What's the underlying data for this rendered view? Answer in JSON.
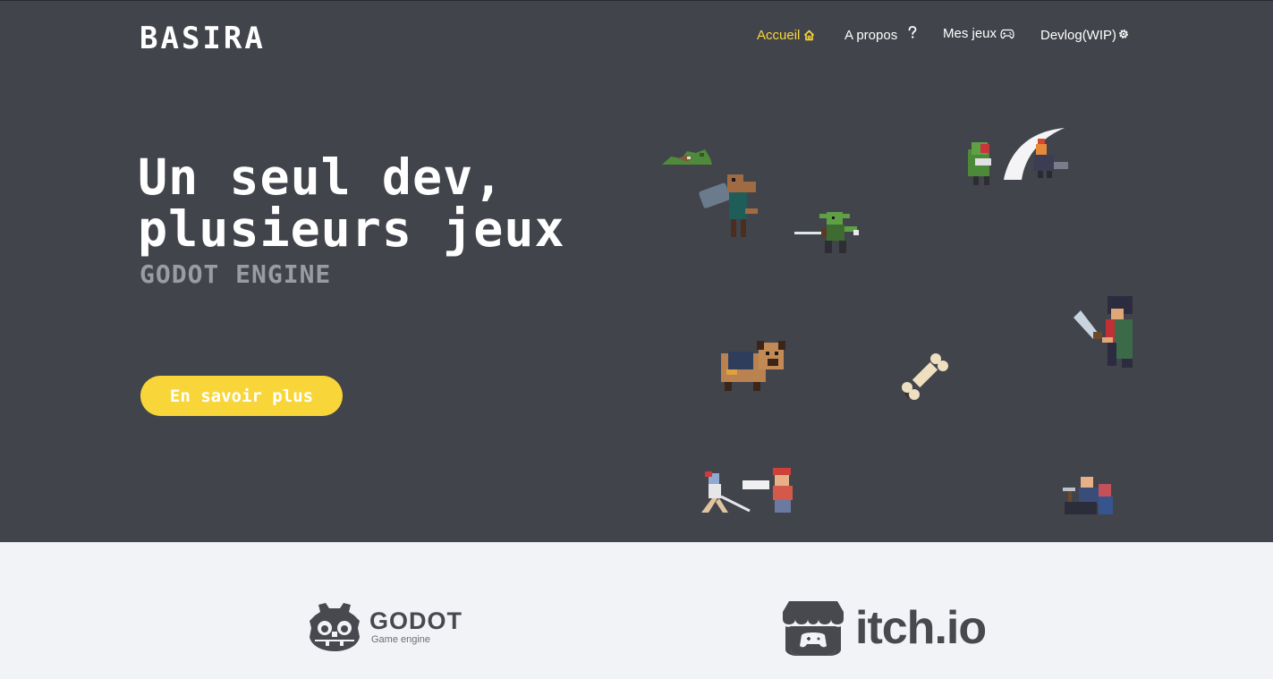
{
  "header": {
    "logo": "BASIRA",
    "nav": [
      {
        "label": "Accueil",
        "icon": "home-icon",
        "active": true
      },
      {
        "label": "A propos",
        "icon": "question-icon",
        "active": false
      },
      {
        "label": "Mes jeux",
        "icon": "gamepad-icon",
        "active": false
      },
      {
        "label": "Devlog(WIP)",
        "icon": "gear-icon",
        "active": false
      }
    ]
  },
  "hero": {
    "headline_line1": "Un seul dev,",
    "headline_line2": "plusieurs jeux",
    "subtitle": "GODOT ENGINE",
    "cta_label": "En savoir plus",
    "sprites": [
      "goblin-pile-sprite",
      "knight-with-hammer-sprite",
      "goblin-swordsman-sprite",
      "goblin-vs-warrior-sprite",
      "pug-dog-sprite",
      "bone-sprite",
      "ninja-swordsman-sprite",
      "fighters-sprite",
      "blacksmith-sprite"
    ]
  },
  "partners": {
    "godot": {
      "name": "GODOT",
      "subtitle": "Game engine"
    },
    "itch": {
      "name": "itch.io"
    }
  },
  "colors": {
    "hero_bg": "#42444c",
    "accent": "#f8d63a",
    "partners_bg": "#f2f3f7",
    "logo_gray": "#48494f"
  }
}
